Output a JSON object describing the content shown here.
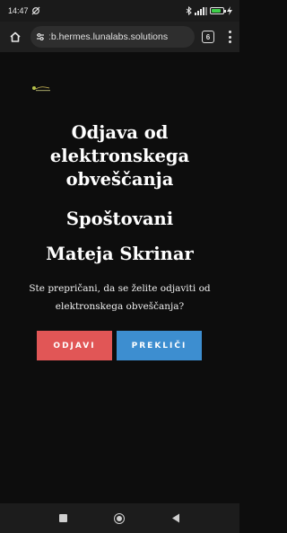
{
  "status_bar": {
    "time": "14:47",
    "icons": [
      "sync-off-icon",
      "bluetooth-icon",
      "signal-icon",
      "battery-icon",
      "charging-icon"
    ],
    "battery_level": 0.85,
    "battery_color": "#3ecf4a"
  },
  "browser": {
    "url": "ːb.hermes.lunalabs.solutions",
    "tab_count": "6",
    "icons": [
      "home-icon",
      "site-settings-icon",
      "tabs-icon",
      "more-menu-icon"
    ]
  },
  "page": {
    "title_line1": "Odjava od",
    "title_line2": "elektronskega",
    "title_line3": "obveščanja",
    "greeting": "Spoštovani",
    "name": "Mateja Skrinar",
    "message": "Ste prepričani, da se želite odjaviti od elektronskega obveščanja?",
    "unsubscribe_label": "ODJAVI",
    "cancel_label": "PREKLIČI",
    "colors": {
      "background": "#0d0d0d",
      "unsubscribe": "#e15656",
      "cancel": "#3d8ed0"
    }
  },
  "nav_bar": {
    "icons": [
      "recents-icon",
      "home-nav-icon",
      "back-icon"
    ]
  }
}
